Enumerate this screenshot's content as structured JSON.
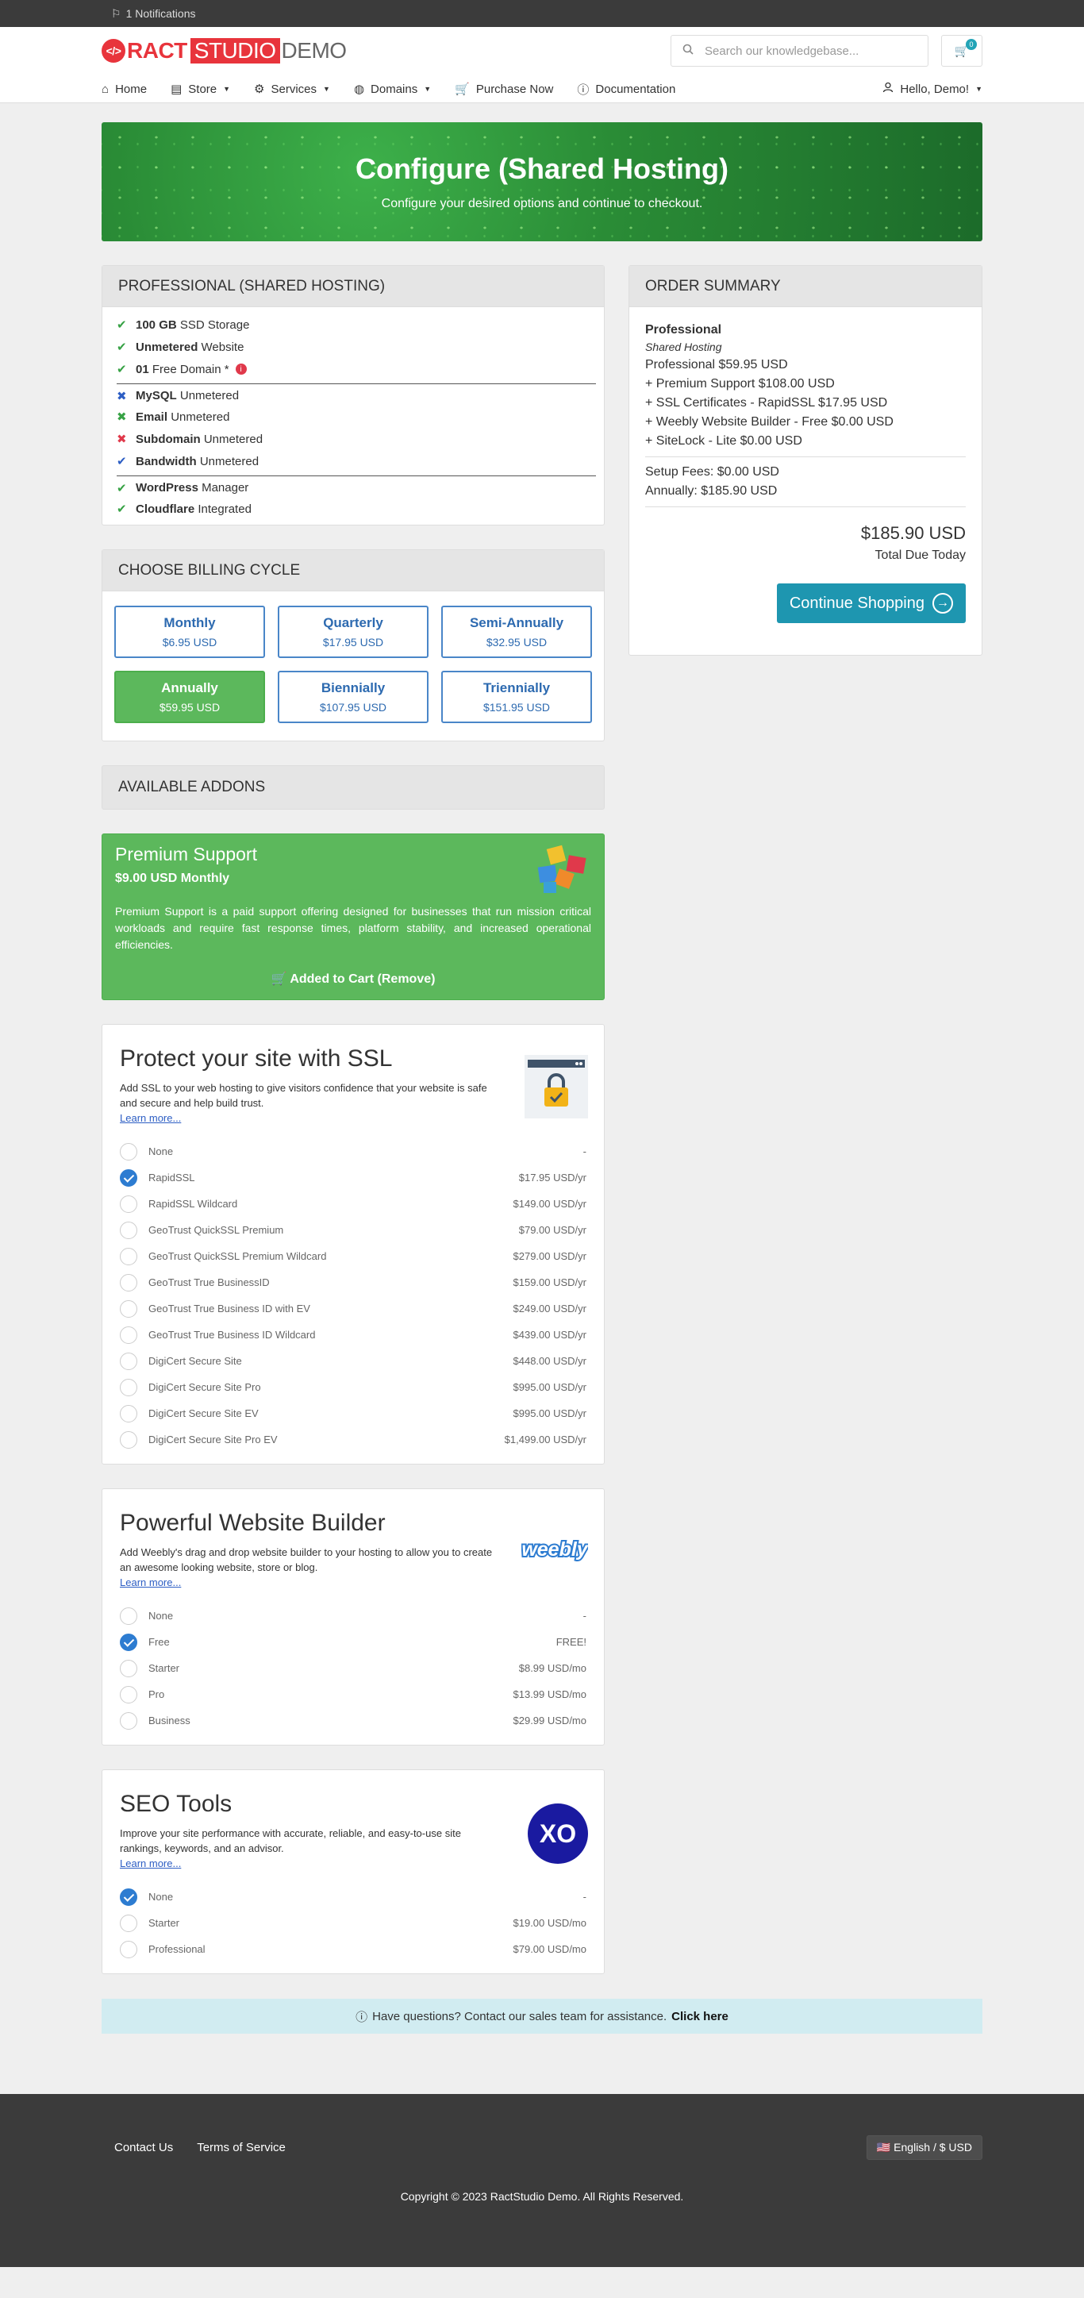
{
  "topbar": {
    "notifications": "1 Notifications"
  },
  "logo": {
    "ract": "RACT",
    "studio": "STUDIO",
    "demo": "DEMO"
  },
  "search": {
    "placeholder": "Search our knowledgebase..."
  },
  "cart": {
    "count": "0"
  },
  "nav": {
    "items": [
      {
        "label": "Home",
        "icon": "home-icon"
      },
      {
        "label": "Store",
        "icon": "store-icon",
        "dropdown": true
      },
      {
        "label": "Services",
        "icon": "services-icon",
        "dropdown": true
      },
      {
        "label": "Domains",
        "icon": "globe-icon",
        "dropdown": true
      },
      {
        "label": "Purchase Now",
        "icon": "cart-icon"
      },
      {
        "label": "Documentation",
        "icon": "info-icon"
      }
    ],
    "user": "Hello, Demo!"
  },
  "hero": {
    "title": "Configure (Shared Hosting)",
    "subtitle": "Configure your desired options and continue to checkout."
  },
  "product": {
    "heading": "PROFESSIONAL (SHARED HOSTING)",
    "features": [
      {
        "bold": "100 GB",
        "text": "SSD Storage",
        "mark": "check-green"
      },
      {
        "bold": "Unmetered",
        "text": "Website",
        "mark": "check-green"
      },
      {
        "bold": "01",
        "text": "Free Domain *",
        "mark": "check-green"
      },
      {
        "bold": "MySQL",
        "text": "Unmetered",
        "mark": "x-blue"
      },
      {
        "bold": "Email",
        "text": "Unmetered",
        "mark": "x-green"
      },
      {
        "bold": "Subdomain",
        "text": "Unmetered",
        "mark": "x-red"
      },
      {
        "bold": "Bandwidth",
        "text": "Unmetered",
        "mark": "check-blue"
      },
      {
        "bold": "WordPress",
        "text": "Manager",
        "mark": "check-green"
      },
      {
        "bold": "Cloudflare",
        "text": "Integrated",
        "mark": "check-green"
      }
    ]
  },
  "billing": {
    "heading": "CHOOSE BILLING CYCLE",
    "options": [
      {
        "term": "Monthly",
        "price": "$6.95 USD",
        "selected": false
      },
      {
        "term": "Quarterly",
        "price": "$17.95 USD",
        "selected": false
      },
      {
        "term": "Semi-Annually",
        "price": "$32.95 USD",
        "selected": false
      },
      {
        "term": "Annually",
        "price": "$59.95 USD",
        "selected": true
      },
      {
        "term": "Biennially",
        "price": "$107.95 USD",
        "selected": false
      },
      {
        "term": "Triennially",
        "price": "$151.95 USD",
        "selected": false
      }
    ]
  },
  "addons": {
    "heading": "AVAILABLE ADDONS",
    "premium": {
      "title": "Premium Support",
      "price": "$9.00 USD Monthly",
      "description": "Premium Support is a paid support offering designed for businesses that run mission critical workloads and require fast response times, platform stability, and increased operational efficiencies.",
      "action": "Added to Cart (Remove)"
    }
  },
  "ssl": {
    "title": "Protect your site with SSL",
    "description": "Add SSL to your web hosting to give visitors confidence that your website is safe and secure and help build trust.",
    "learn": "Learn more...",
    "options": [
      {
        "name": "None",
        "price": "-",
        "selected": false
      },
      {
        "name": "RapidSSL",
        "price": "$17.95 USD/yr",
        "selected": true
      },
      {
        "name": "RapidSSL Wildcard",
        "price": "$149.00 USD/yr",
        "selected": false
      },
      {
        "name": "GeoTrust QuickSSL Premium",
        "price": "$79.00 USD/yr",
        "selected": false
      },
      {
        "name": "GeoTrust QuickSSL Premium Wildcard",
        "price": "$279.00 USD/yr",
        "selected": false
      },
      {
        "name": "GeoTrust True BusinessID",
        "price": "$159.00 USD/yr",
        "selected": false
      },
      {
        "name": "GeoTrust True Business ID with EV",
        "price": "$249.00 USD/yr",
        "selected": false
      },
      {
        "name": "GeoTrust True Business ID Wildcard",
        "price": "$439.00 USD/yr",
        "selected": false
      },
      {
        "name": "DigiCert Secure Site",
        "price": "$448.00 USD/yr",
        "selected": false
      },
      {
        "name": "DigiCert Secure Site Pro",
        "price": "$995.00 USD/yr",
        "selected": false
      },
      {
        "name": "DigiCert Secure Site EV",
        "price": "$995.00 USD/yr",
        "selected": false
      },
      {
        "name": "DigiCert Secure Site Pro EV",
        "price": "$1,499.00 USD/yr",
        "selected": false
      }
    ]
  },
  "weebly": {
    "title": "Powerful Website Builder",
    "description": "Add Weebly's drag and drop website builder to your hosting to allow you to create an awesome looking website, store or blog.",
    "learn": "Learn more...",
    "logo": "weebly",
    "options": [
      {
        "name": "None",
        "price": "-",
        "selected": false
      },
      {
        "name": "Free",
        "price": "FREE!",
        "selected": true
      },
      {
        "name": "Starter",
        "price": "$8.99 USD/mo",
        "selected": false
      },
      {
        "name": "Pro",
        "price": "$13.99 USD/mo",
        "selected": false
      },
      {
        "name": "Business",
        "price": "$29.99 USD/mo",
        "selected": false
      }
    ]
  },
  "seo": {
    "title": "SEO Tools",
    "description": "Improve your site performance with accurate, reliable, and easy-to-use site rankings, keywords, and an advisor.",
    "learn": "Learn more...",
    "logo": "XO",
    "options": [
      {
        "name": "None",
        "price": "-",
        "selected": true
      },
      {
        "name": "Starter",
        "price": "$19.00 USD/mo",
        "selected": false
      },
      {
        "name": "Professional",
        "price": "$79.00 USD/mo",
        "selected": false
      }
    ]
  },
  "summary": {
    "heading": "ORDER SUMMARY",
    "product": "Professional",
    "group": "Shared Hosting",
    "lines": [
      "Professional $59.95 USD",
      "+ Premium Support $108.00 USD",
      "+ SSL Certificates - RapidSSL $17.95 USD",
      "+ Weebly Website Builder - Free $0.00 USD",
      "+ SiteLock - Lite $0.00 USD"
    ],
    "setup": "Setup Fees: $0.00 USD",
    "annually": "Annually: $185.90 USD",
    "total": "$185.90 USD",
    "total_label": "Total Due Today",
    "continue": "Continue Shopping"
  },
  "help": {
    "text": "Have questions? Contact our sales team for assistance.",
    "link": "Click here"
  },
  "footer": {
    "links": [
      "Contact Us",
      "Terms of Service"
    ],
    "language": "English / $ USD",
    "copyright": "Copyright © 2023 RactStudio Demo. All Rights Reserved."
  },
  "colors": {
    "accent": "#1e96b0",
    "success": "#5cb85c",
    "link": "#2d5ec4",
    "topbar": "#3b3b3b"
  }
}
